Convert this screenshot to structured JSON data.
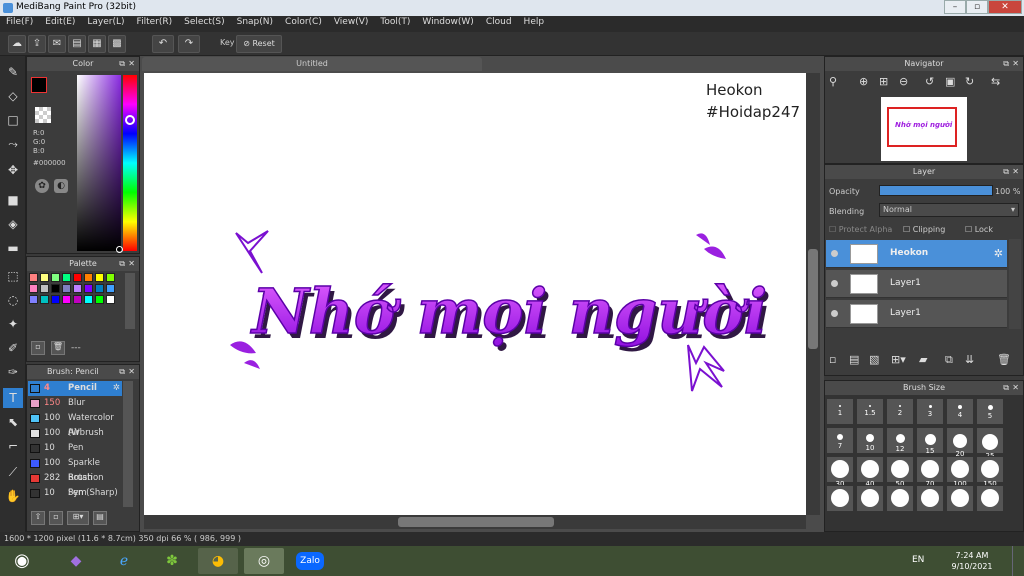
{
  "window": {
    "title": "MediBang Paint Pro (32bit)"
  },
  "menu": [
    "File(F)",
    "Edit(E)",
    "Layer(L)",
    "Filter(R)",
    "Select(S)",
    "Snap(N)",
    "Color(C)",
    "View(V)",
    "Tool(T)",
    "Window(W)",
    "Cloud",
    "Help"
  ],
  "toolbar": {
    "key_label": "Key",
    "reset_label": "Reset"
  },
  "color_panel": {
    "title": "Color",
    "r": "R:0",
    "g": "G:0",
    "b": "B:0",
    "hex": "#000000"
  },
  "palette_panel": {
    "title": "Palette",
    "footer": "---"
  },
  "brush_panel": {
    "title": "Brush: Pencil",
    "items": [
      {
        "size": "4",
        "name": "Pencil",
        "color": "#2f7fd0"
      },
      {
        "size": "150",
        "name": "Blur",
        "color": "#e8a0c8"
      },
      {
        "size": "100",
        "name": "Watercolor (W",
        "color": "#4fc3f7"
      },
      {
        "size": "100",
        "name": "Airbrush",
        "color": "#e0e0e0"
      },
      {
        "size": "10",
        "name": "Pen",
        "color": "#333333"
      },
      {
        "size": "100",
        "name": "Sparkle Brush",
        "color": "#3d5afe"
      },
      {
        "size": "282",
        "name": "Rotation Sym",
        "color": "#e53935"
      },
      {
        "size": "10",
        "name": "Pen (Sharp)",
        "color": "#333333"
      }
    ]
  },
  "canvas": {
    "tab": "Untitled",
    "signature1": "Heokon",
    "signature2": "#Hoidap247",
    "artwork_text": "Nhớ mọi người"
  },
  "navigator": {
    "title": "Navigator"
  },
  "layer_panel": {
    "title": "Layer",
    "opacity_label": "Opacity",
    "opacity_value": "100 %",
    "blending_label": "Blending",
    "blending_value": "Normal",
    "protect_alpha": "Protect Alpha",
    "clipping": "Clipping",
    "lock": "Lock",
    "layers": [
      {
        "name": "Heokon",
        "selected": true
      },
      {
        "name": "Layer1",
        "selected": false
      },
      {
        "name": "Layer1",
        "selected": false
      }
    ]
  },
  "brush_size_panel": {
    "title": "Brush Size",
    "sizes": [
      "1",
      "1.5",
      "2",
      "3",
      "4",
      "5",
      "7",
      "10",
      "12",
      "15",
      "20",
      "25",
      "30",
      "40",
      "50",
      "70",
      "100",
      "150",
      "",
      "",
      "",
      "",
      "",
      ""
    ]
  },
  "status": {
    "text": "1600 * 1200 pixel   (11.6 * 8.7cm)   350 dpi   66 %   ( 986, 999 )"
  },
  "taskbar": {
    "lang": "EN",
    "time": "7:24 AM",
    "date": "9/10/2021"
  }
}
